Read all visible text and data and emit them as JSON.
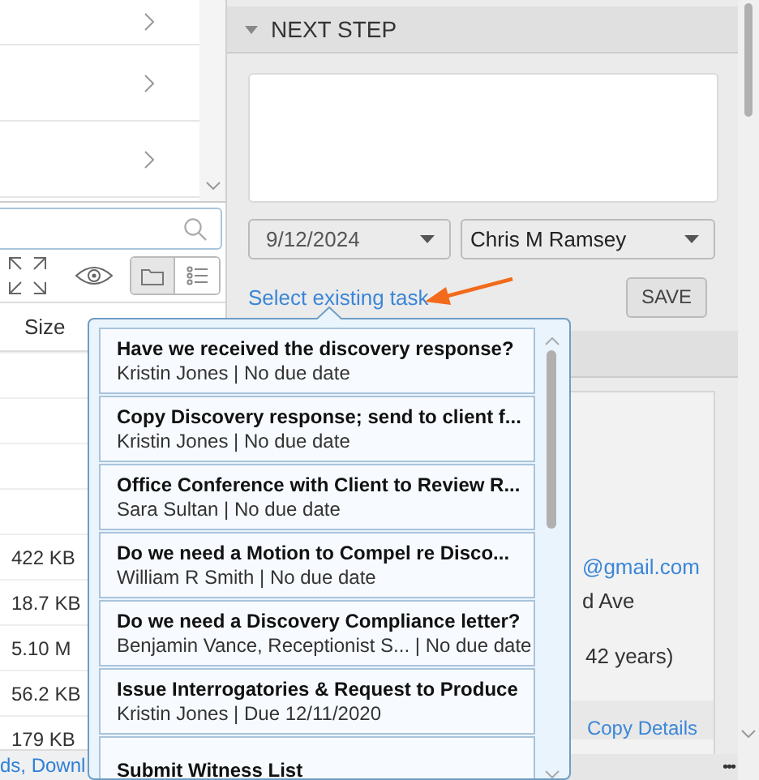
{
  "files": {
    "columns": [
      "Size"
    ],
    "rows": [
      {
        "size": "422 KB"
      },
      {
        "size": "18.7 KB"
      },
      {
        "size": "5.10 M"
      },
      {
        "size": "56.2 KB"
      },
      {
        "size": "179 KB"
      }
    ]
  },
  "next_step": {
    "title": "NEXT STEP",
    "date": "9/12/2024",
    "assignee": "Chris M Ramsey",
    "link": "Select existing task",
    "save": "SAVE"
  },
  "details": {
    "email": "@gmail.com",
    "address": "d Ave",
    "age": "42 years)",
    "copy": "Copy Details"
  },
  "status_bar": {
    "link": "ds, Downl",
    "more": "•••"
  },
  "tasks": [
    {
      "title": "Have we received the discovery response?",
      "subtitle": "Kristin Jones | No due date"
    },
    {
      "title": "Copy Discovery response; send to client f...",
      "subtitle": "Kristin Jones | No due date"
    },
    {
      "title": "Office Conference with Client to Review R...",
      "subtitle": "Sara Sultan | No due date"
    },
    {
      "title": "Do we need a Motion to Compel re Disco...",
      "subtitle": "William R Smith | No due date"
    },
    {
      "title": "Do we need a Discovery Compliance letter?",
      "subtitle": "Benjamin Vance, Receptionist S... | No due date"
    },
    {
      "title": "Issue Interrogatories & Request to Produce",
      "subtitle": "Kristin Jones | Due 12/11/2020"
    },
    {
      "title": "Submit Witness List"
    }
  ]
}
